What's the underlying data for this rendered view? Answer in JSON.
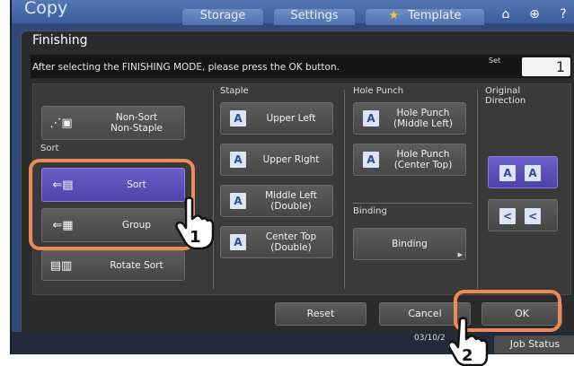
{
  "topbar": {
    "app_title": "Copy",
    "tabs": [
      "Storage",
      "Settings",
      "Template"
    ],
    "icons": [
      "star-icon",
      "home-icon",
      "globe-icon",
      "help-icon"
    ]
  },
  "dialog": {
    "title": "Finishing",
    "message": "After selecting the FINISHING MODE, please press the OK button.",
    "set_label": "Set",
    "set_value": "1"
  },
  "sections": {
    "sort": "Sort",
    "staple": "Staple",
    "hole_punch": "Hole Punch",
    "binding": "Binding",
    "original_direction": "Original\nDirection"
  },
  "buttons": {
    "non_sort": "Non-Sort\nNon-Staple",
    "sort": "Sort",
    "group": "Group",
    "rotate_sort": "Rotate Sort",
    "upper_left": "Upper Left",
    "upper_right": "Upper Right",
    "middle_left": "Middle Left\n(Double)",
    "center_top": "Center Top\n(Double)",
    "hp_middle_left": "Hole Punch\n(Middle Left)",
    "hp_center_top": "Hole Punch\n(Center Top)",
    "binding": "Binding",
    "reset": "Reset",
    "cancel": "Cancel",
    "ok": "OK"
  },
  "status": {
    "date_fragment": "03/10/2",
    "job_status": "Job Status"
  },
  "callouts": [
    "1",
    "2"
  ],
  "colors": {
    "accent_orange": "#ee8a5a",
    "selected_purple": "#5a4cb8",
    "header_blue": "#3a5d9d"
  }
}
